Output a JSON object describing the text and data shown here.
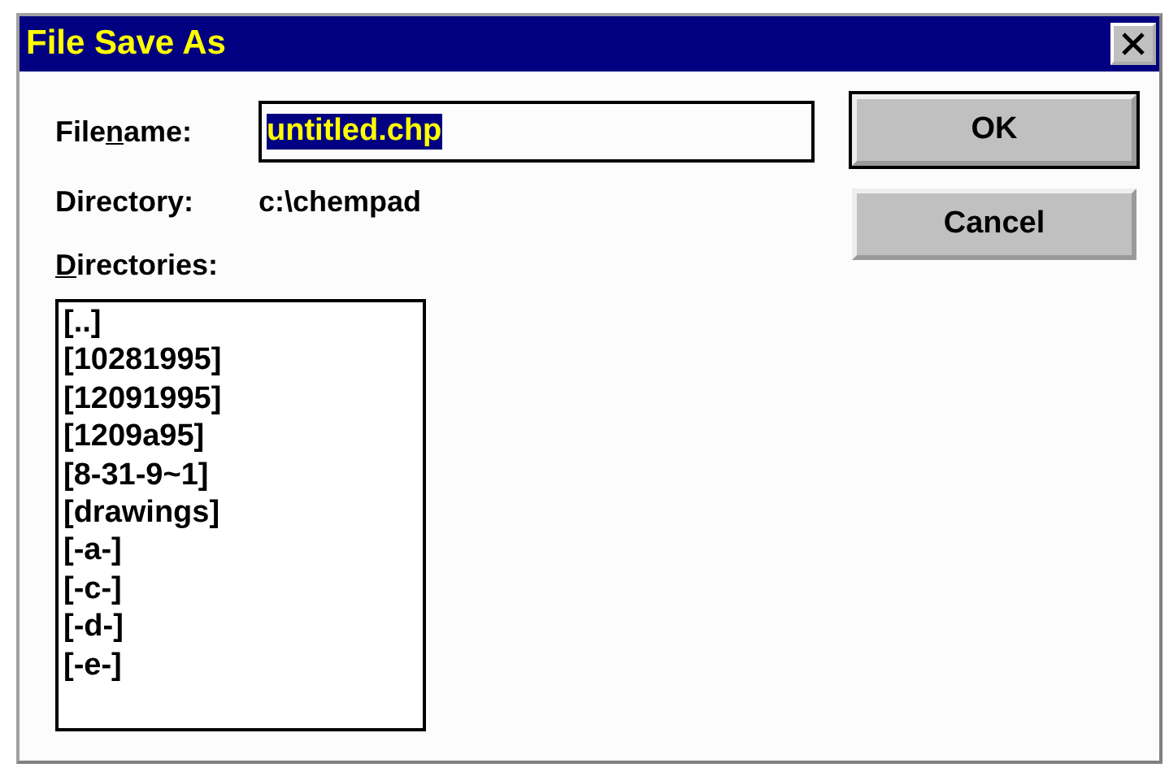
{
  "window": {
    "title": "File Save As"
  },
  "filename": {
    "label": {
      "before": "File",
      "mnemonic": "n",
      "after": "ame:"
    },
    "value": "untitled.chp",
    "value_selected": true
  },
  "directory": {
    "label": "Directory:",
    "value": "c:\\chempad"
  },
  "directories": {
    "label": {
      "mnemonic": "D",
      "after": "irectories:"
    },
    "items": [
      {
        "text": "[..]"
      },
      {
        "text": "[10281995]"
      },
      {
        "text": "[12091995]"
      },
      {
        "text": "[1209a95]"
      },
      {
        "text": "[8-31-9~1]"
      },
      {
        "text": "[drawings]"
      },
      {
        "text": "[-a-]"
      },
      {
        "text": "[-c-]"
      },
      {
        "text": "[-d-]"
      },
      {
        "text": "[-e-]"
      }
    ]
  },
  "buttons": [
    {
      "label": "OK",
      "default": true
    },
    {
      "label": "Cancel",
      "default": false
    }
  ]
}
